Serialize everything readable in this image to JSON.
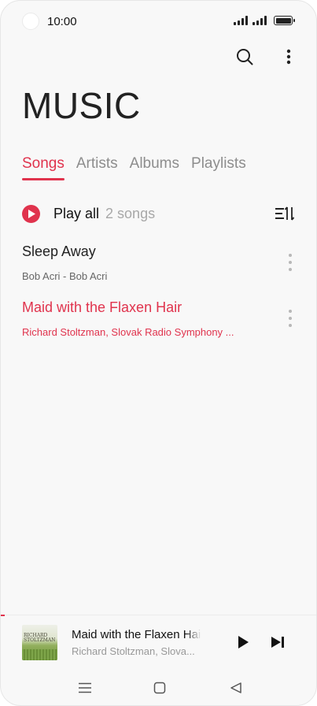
{
  "status_bar": {
    "time": "10:00"
  },
  "header": {
    "title": "MUSIC"
  },
  "tabs": [
    {
      "label": "Songs",
      "active": true
    },
    {
      "label": "Artists",
      "active": false
    },
    {
      "label": "Albums",
      "active": false
    },
    {
      "label": "Playlists",
      "active": false
    }
  ],
  "play_all": {
    "label": "Play all",
    "count_text": "2 songs"
  },
  "songs": [
    {
      "title": "Sleep Away",
      "subtitle": "Bob Acri - Bob Acri",
      "playing": false
    },
    {
      "title": "Maid with the Flaxen Hair",
      "subtitle": "Richard Stoltzman, Slovak Radio Symphony ...",
      "playing": true
    }
  ],
  "mini_player": {
    "title": "Maid with the Flaxen Hair",
    "artist": "Richard Stoltzman, Slova...",
    "album_art_text": "RICHARD STOLTZMAN"
  },
  "icons": {
    "search": "search-icon",
    "more": "more-vertical-icon",
    "play": "play-icon",
    "sort": "sort-icon",
    "next": "skip-next-icon",
    "menu": "menu-icon",
    "home": "home-icon",
    "back": "back-icon"
  },
  "colors": {
    "accent": "#e0334d",
    "text": "#222222",
    "muted": "#8d8d8d",
    "background": "#f8f8f8"
  }
}
